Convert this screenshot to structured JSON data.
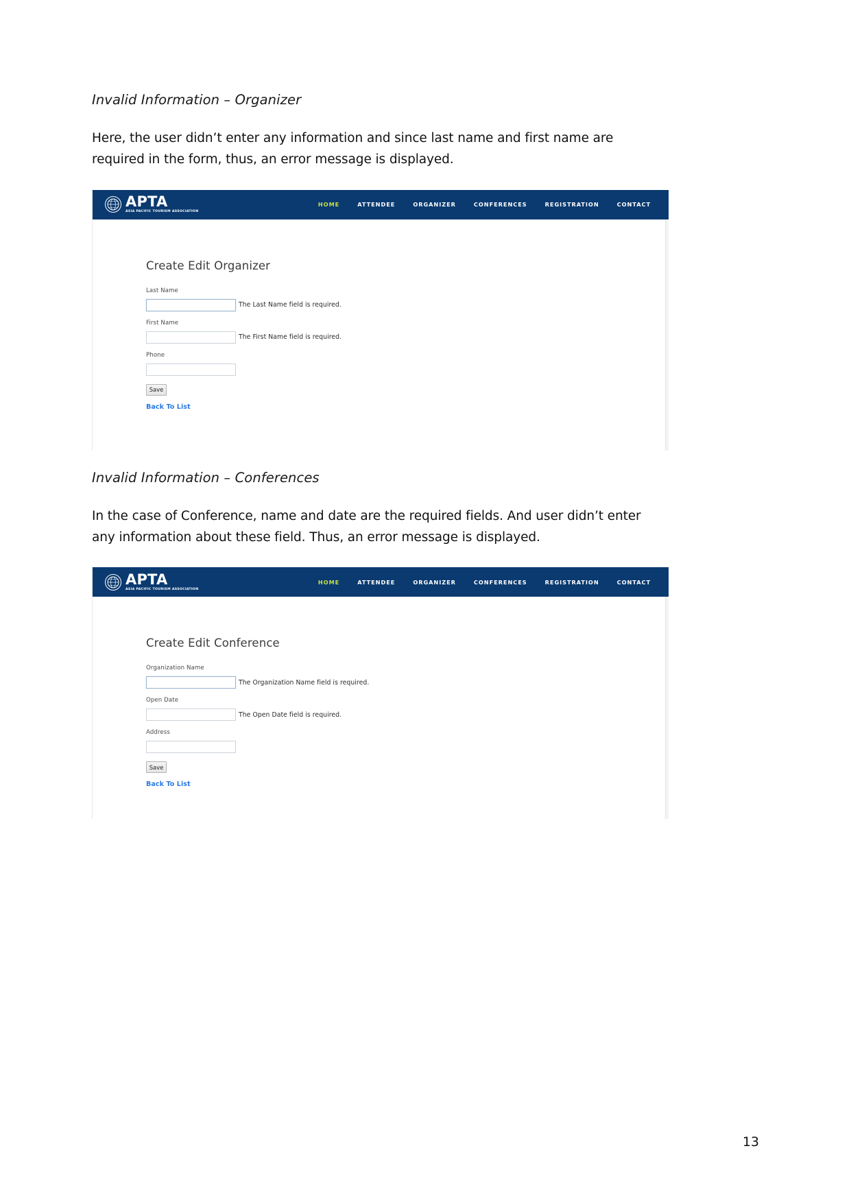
{
  "document": {
    "sections": [
      {
        "heading": "Invalid Information – Organizer",
        "paragraph": "Here, the user didn’t enter any information and since last name and first name are required in the form, thus, an error message is displayed."
      },
      {
        "heading": "Invalid Information – Conferences",
        "paragraph": "In the case of Conference, name and date are the required fields. And user didn’t enter any information about these field. Thus, an error message is displayed."
      }
    ],
    "page_number": "13"
  },
  "colors": {
    "nav_background": "#0a3a70",
    "nav_active_link": "#c8e04a",
    "nav_link": "#ffffff",
    "link_blue": "#2a7ae2",
    "input_border": "#ccd3da",
    "input_border_focus": "#9bb4d0"
  },
  "screenshots": [
    {
      "nav": {
        "logo": {
          "icon": "globe-icon",
          "wordmark": "APTA",
          "tagline": "ASIA PACIFIC TOURISM ASSOCIATION"
        },
        "items": [
          {
            "label": "HOME",
            "active": true
          },
          {
            "label": "ATTENDEE",
            "active": false
          },
          {
            "label": "ORGANIZER",
            "active": false
          },
          {
            "label": "CONFERENCES",
            "active": false
          },
          {
            "label": "REGISTRATION",
            "active": false
          },
          {
            "label": "CONTACT",
            "active": false
          }
        ]
      },
      "form": {
        "title": "Create Edit Organizer",
        "fields": [
          {
            "label": "Last Name",
            "value": "",
            "error": "The Last Name field is required.",
            "focused": true
          },
          {
            "label": "First Name",
            "value": "",
            "error": "The First Name field is required.",
            "focused": false
          },
          {
            "label": "Phone",
            "value": "",
            "error": "",
            "focused": false
          }
        ],
        "save_label": "Save",
        "back_link_label": "Back To List"
      }
    },
    {
      "nav": {
        "logo": {
          "icon": "globe-icon",
          "wordmark": "APTA",
          "tagline": "ASIA PACIFIC TOURISM ASSOCIATION"
        },
        "items": [
          {
            "label": "HOME",
            "active": true
          },
          {
            "label": "ATTENDEE",
            "active": false
          },
          {
            "label": "ORGANIZER",
            "active": false
          },
          {
            "label": "CONFERENCES",
            "active": false
          },
          {
            "label": "REGISTRATION",
            "active": false
          },
          {
            "label": "CONTACT",
            "active": false
          }
        ]
      },
      "form": {
        "title": "Create Edit Conference",
        "fields": [
          {
            "label": "Organization Name",
            "value": "",
            "error": "The Organization Name field is required.",
            "focused": true
          },
          {
            "label": "Open Date",
            "value": "",
            "error": "The Open Date field is required.",
            "focused": false
          },
          {
            "label": "Address",
            "value": "",
            "error": "",
            "focused": false
          }
        ],
        "save_label": "Save",
        "back_link_label": "Back To List"
      }
    }
  ]
}
